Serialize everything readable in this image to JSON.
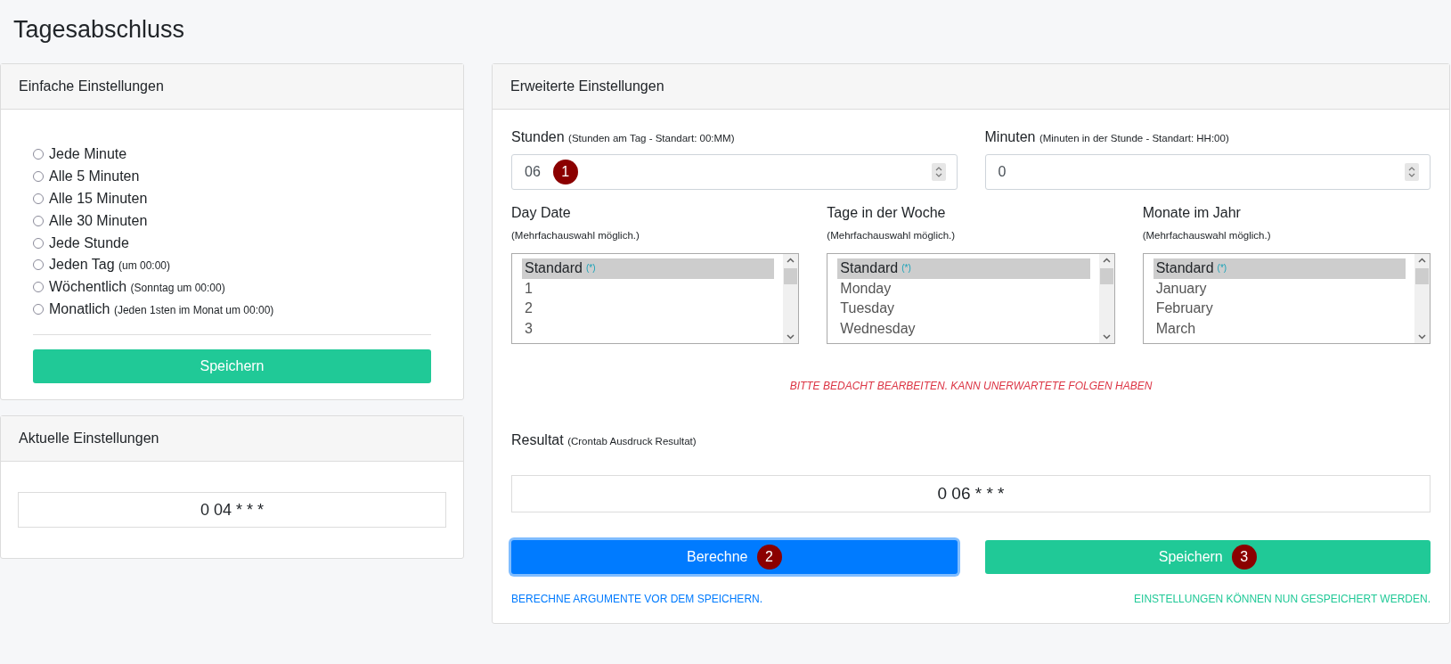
{
  "page_title": "Tagesabschluss",
  "simple_settings": {
    "title": "Einfache Einstellungen",
    "options": [
      {
        "label": "Jede Minute",
        "selected": false
      },
      {
        "label": "Alle 5 Minuten",
        "selected": false
      },
      {
        "label": "Alle 15 Minuten",
        "selected": false
      },
      {
        "label": "Alle 30 Minuten",
        "selected": false
      },
      {
        "label": "Jede Stunde",
        "selected": false
      },
      {
        "label": "Jeden Tag",
        "note": "(um 00:00)",
        "selected": false
      },
      {
        "label": "Wöchentlich",
        "note": "(Sonntag um 00:00)",
        "selected": false
      },
      {
        "label": "Monatlich",
        "note": "(Jeden 1sten im Monat um 00:00)",
        "selected": false
      }
    ],
    "save_button": "Speichern"
  },
  "current_settings": {
    "title": "Aktuelle Einstellungen",
    "value": "0 04 * * *"
  },
  "advanced_settings": {
    "title": "Erweiterte Einstellungen",
    "number_fields": [
      {
        "label": "Stunden",
        "hint": "(Stunden am Tag - Standart: 00:MM)",
        "value": "06",
        "badge": "1"
      },
      {
        "label": "Minuten",
        "hint": "(Minuten in der Stunde - Standart: HH:00)",
        "value": "0"
      }
    ],
    "lists": [
      {
        "label": "Day Date",
        "hint": "(Mehrfachauswahl möglich.)",
        "items": [
          {
            "label": "Standard",
            "suffix": "(*)",
            "selected": true
          },
          {
            "label": "1",
            "selected": false
          },
          {
            "label": "2",
            "selected": false
          },
          {
            "label": "3",
            "selected": false
          }
        ]
      },
      {
        "label": "Tage in der Woche",
        "hint": "(Mehrfachauswahl möglich.)",
        "items": [
          {
            "label": "Standard",
            "suffix": "(*)",
            "selected": true
          },
          {
            "label": "Monday",
            "selected": false
          },
          {
            "label": "Tuesday",
            "selected": false
          },
          {
            "label": "Wednesday",
            "selected": false
          }
        ]
      },
      {
        "label": "Monate im Jahr",
        "hint": "(Mehrfachauswahl möglich.)",
        "items": [
          {
            "label": "Standard",
            "suffix": "(*)",
            "selected": true
          },
          {
            "label": "January",
            "selected": false
          },
          {
            "label": "February",
            "selected": false
          },
          {
            "label": "March",
            "selected": false
          }
        ]
      }
    ],
    "warning": "BITTE BEDACHT BEARBEITEN. KANN UNERWARTETE FOLGEN HABEN",
    "result": {
      "label": "Resultat",
      "hint": "(Crontab Ausdruck Resultat)",
      "value": "0 06 * * *"
    },
    "buttons": [
      {
        "kind": "primary",
        "label": "Berechne",
        "badge": "2",
        "focused": true,
        "message": "BERECHNE ARGUMENTE VOR DEM SPEICHERN."
      },
      {
        "kind": "success",
        "label": "Speichern",
        "badge": "3",
        "focused": false,
        "message": "EINSTELLUNGEN KÖNNEN NUN GESPEICHERT WERDEN."
      }
    ]
  }
}
